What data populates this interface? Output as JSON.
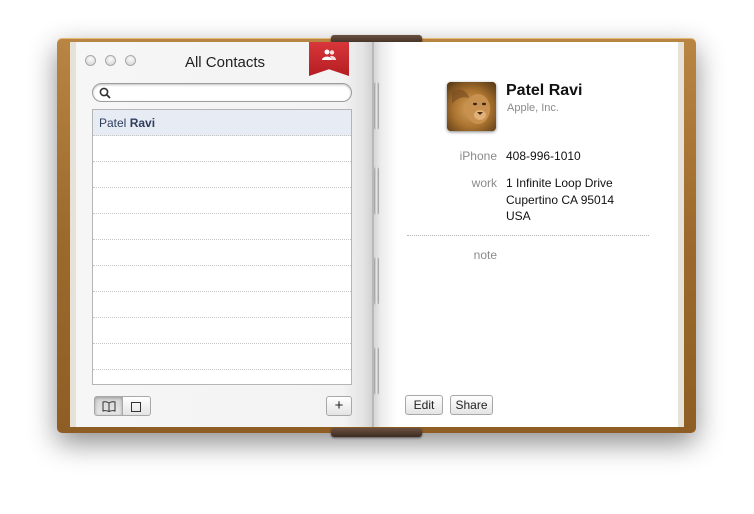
{
  "window": {
    "title": "All Contacts"
  },
  "search": {
    "placeholder": ""
  },
  "contacts": [
    {
      "first": "Patel ",
      "last": "Ravi",
      "selected": true
    }
  ],
  "empty_rows": 10,
  "left_toolbar": {
    "view_card_icon": "book-icon",
    "view_single_icon": "square-icon",
    "add_label": "+"
  },
  "card": {
    "name": "Patel Ravi",
    "company": "Apple, Inc.",
    "phone_label": "iPhone",
    "phone": "408-996-1010",
    "address_label": "work",
    "address_lines": [
      "1 Infinite Loop Drive",
      "Cupertino CA 95014",
      "USA"
    ],
    "note_label": "note",
    "edit_label": "Edit",
    "share_label": "Share"
  },
  "colors": {
    "leather": "#9c6a2c",
    "ribbon": "#c62a2e",
    "selected_row": "#e7ebf3"
  }
}
